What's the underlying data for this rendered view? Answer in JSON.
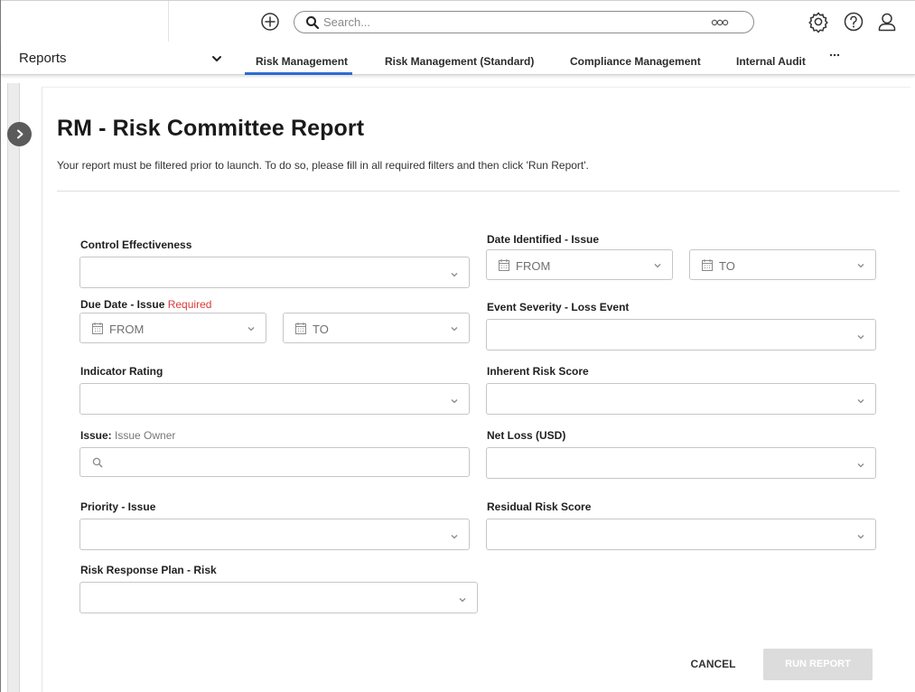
{
  "topbar": {
    "search_placeholder": "Search..."
  },
  "navbar": {
    "reports_label": "Reports",
    "tabs": [
      {
        "label": "Risk Management",
        "active": true
      },
      {
        "label": "Risk Management (Standard)",
        "active": false
      },
      {
        "label": "Compliance Management",
        "active": false
      },
      {
        "label": "Internal Audit",
        "active": false
      }
    ]
  },
  "page": {
    "title": "RM - Risk Committee Report",
    "description": "Your report must be filtered prior to launch. To do so, please fill in all required filters and then click 'Run Report'."
  },
  "filters": {
    "control_effectiveness": {
      "label": "Control Effectiveness"
    },
    "due_date_issue": {
      "label": "Due Date - Issue",
      "required_text": "Required",
      "from": "FROM",
      "to": "TO"
    },
    "indicator_rating": {
      "label": "Indicator Rating"
    },
    "issue_owner": {
      "label": "Issue:",
      "sub_label": "Issue Owner"
    },
    "priority_issue": {
      "label": "Priority - Issue"
    },
    "risk_response_plan": {
      "label": "Risk Response Plan - Risk"
    },
    "date_identified_issue": {
      "label": "Date Identified - Issue",
      "from": "FROM",
      "to": "TO"
    },
    "event_severity": {
      "label": "Event Severity - Loss Event"
    },
    "inherent_risk_score": {
      "label": "Inherent Risk Score"
    },
    "net_loss": {
      "label": "Net Loss (USD)"
    },
    "residual_risk_score": {
      "label": "Residual Risk Score"
    }
  },
  "actions": {
    "cancel": "CANCEL",
    "run_report": "RUN REPORT"
  },
  "colors": {
    "accent": "#2d6bd3",
    "required": "#d93a3a",
    "disabled_button": "#dcdcdc"
  }
}
